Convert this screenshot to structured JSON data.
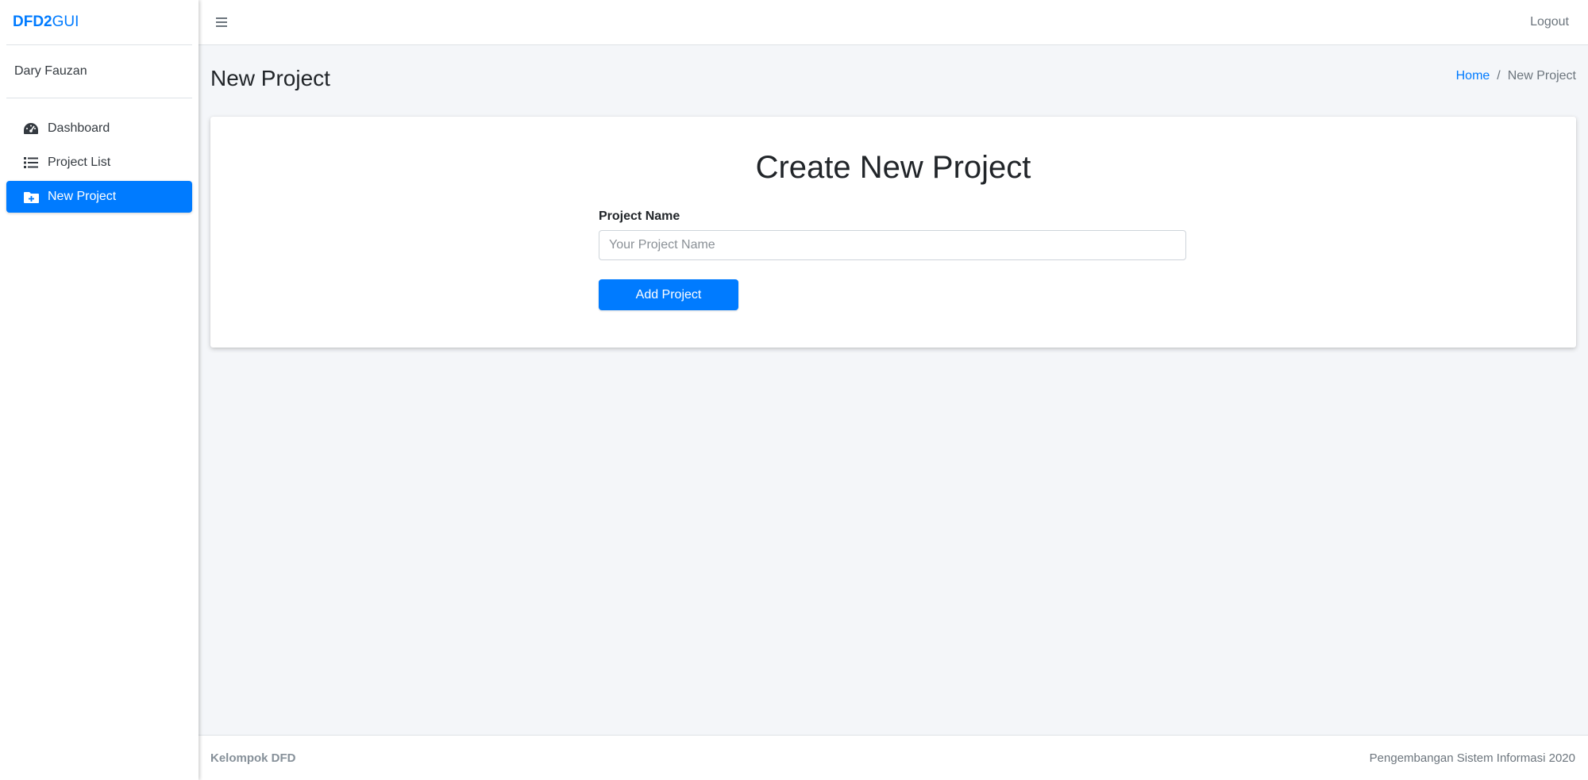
{
  "brand": {
    "bold": "DFD2",
    "light": "GUI"
  },
  "user": {
    "name": "Dary Fauzan"
  },
  "sidebar": {
    "items": [
      {
        "label": "Dashboard",
        "icon": "tachometer-icon",
        "active": false
      },
      {
        "label": "Project List",
        "icon": "list-icon",
        "active": false
      },
      {
        "label": "New Project",
        "icon": "folder-plus-icon",
        "active": true
      }
    ]
  },
  "header": {
    "menu_icon": "hamburger-icon",
    "logout_label": "Logout"
  },
  "content": {
    "page_title": "New Project",
    "breadcrumb": {
      "home": "Home",
      "separator": "/",
      "current": "New Project"
    }
  },
  "card": {
    "title": "Create New Project",
    "field_label": "Project Name",
    "field_placeholder": "Your Project Name",
    "field_value": "",
    "submit_label": "Add Project"
  },
  "footer": {
    "left": "Kelompok DFD",
    "right": "Pengembangan Sistem Informasi 2020"
  },
  "colors": {
    "primary": "#007bff",
    "background": "#f4f6f9",
    "sidebar": "#ffffff"
  }
}
